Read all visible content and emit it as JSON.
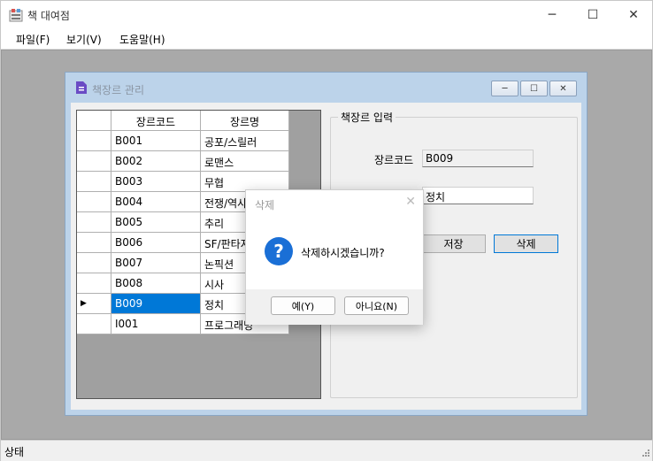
{
  "window": {
    "title": "책 대여점"
  },
  "menu": {
    "file": "파일(F)",
    "view": "보기(V)",
    "help": "도움말(H)"
  },
  "status": {
    "text": "상태"
  },
  "child": {
    "title": "책장르 관리"
  },
  "grid": {
    "headers": [
      "장르코드",
      "장르명"
    ],
    "rows": [
      {
        "code": "B001",
        "name": "공포/스릴러"
      },
      {
        "code": "B002",
        "name": "로맨스"
      },
      {
        "code": "B003",
        "name": "무협"
      },
      {
        "code": "B004",
        "name": "전쟁/역사"
      },
      {
        "code": "B005",
        "name": "추리"
      },
      {
        "code": "B006",
        "name": "SF/판타지"
      },
      {
        "code": "B007",
        "name": "논픽션"
      },
      {
        "code": "B008",
        "name": "시사"
      },
      {
        "code": "B009",
        "name": "정치"
      },
      {
        "code": "I001",
        "name": "프로그래밍"
      }
    ],
    "selected_row": 8,
    "row_marker": "▶"
  },
  "form": {
    "group_title": "책장르 입력",
    "code_label": "장르코드",
    "code_value": "B009",
    "name_value": "정치",
    "save_label": "저장",
    "delete_label": "삭제"
  },
  "dialog": {
    "title": "삭제",
    "message": "삭제하시겠습니까?",
    "icon_glyph": "?",
    "yes_label": "예(Y)",
    "no_label": "아니요(N)"
  },
  "icons": {
    "minimize": "─",
    "maximize": "☐",
    "close": "✕"
  },
  "colors": {
    "selection": "#0078d7",
    "mdi_background": "#a9a9a9",
    "dialog_icon": "#1a6fd6"
  }
}
